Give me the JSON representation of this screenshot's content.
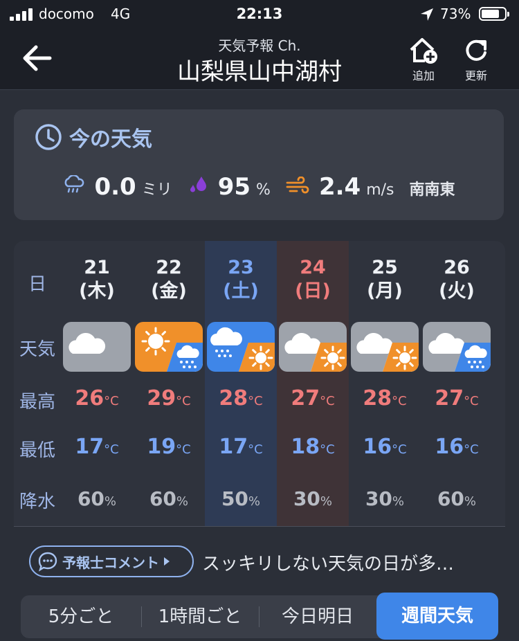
{
  "status_bar": {
    "carrier": "docomo",
    "network": "4G",
    "time": "22:13",
    "battery": "73%"
  },
  "header": {
    "subtitle": "天気予報 Ch.",
    "title": "山梨県山中湖村",
    "add_label": "追加",
    "refresh_label": "更新"
  },
  "now": {
    "title": "今の天気",
    "rain": "0.0",
    "rain_unit": "ミリ",
    "humidity": "95",
    "humidity_unit": "%",
    "wind": "2.4",
    "wind_unit": "m/s",
    "wind_dir": "南南東"
  },
  "week": {
    "labels": {
      "day": "日",
      "weather": "天気",
      "high": "最高",
      "low": "最低",
      "precip": "降水"
    },
    "temp_unit": "°C",
    "precip_unit": "%",
    "days": [
      {
        "date": "21",
        "dow": "(木)",
        "kind": "normal",
        "weather": "cloudy",
        "high": "26",
        "low": "17",
        "precip": "60"
      },
      {
        "date": "22",
        "dow": "(金)",
        "kind": "normal",
        "weather": "sunny-then-rain",
        "high": "29",
        "low": "19",
        "precip": "60"
      },
      {
        "date": "23",
        "dow": "(土)",
        "kind": "sat",
        "weather": "rain-then-sunny",
        "high": "28",
        "low": "17",
        "precip": "50"
      },
      {
        "date": "24",
        "dow": "(日)",
        "kind": "sun",
        "weather": "cloudy-then-sunny",
        "high": "27",
        "low": "18",
        "precip": "30"
      },
      {
        "date": "25",
        "dow": "(月)",
        "kind": "normal",
        "weather": "cloudy-then-sunny",
        "high": "28",
        "low": "16",
        "precip": "30"
      },
      {
        "date": "26",
        "dow": "(火)",
        "kind": "normal",
        "weather": "cloudy-then-rain",
        "high": "27",
        "low": "16",
        "precip": "60"
      }
    ]
  },
  "comment": {
    "pill_label": "予報士コメント",
    "text": "スッキリしない天気の日が多…"
  },
  "tabs": [
    {
      "label": "5分ごと"
    },
    {
      "label": "1時間ごと"
    },
    {
      "label": "今日明日"
    },
    {
      "label": "週間天気",
      "active": true
    }
  ],
  "colors": {
    "sunny": "#f0902a",
    "rain": "#3f86e8",
    "cloudy": "#9ea3ab",
    "accent": "#3f86e8"
  }
}
